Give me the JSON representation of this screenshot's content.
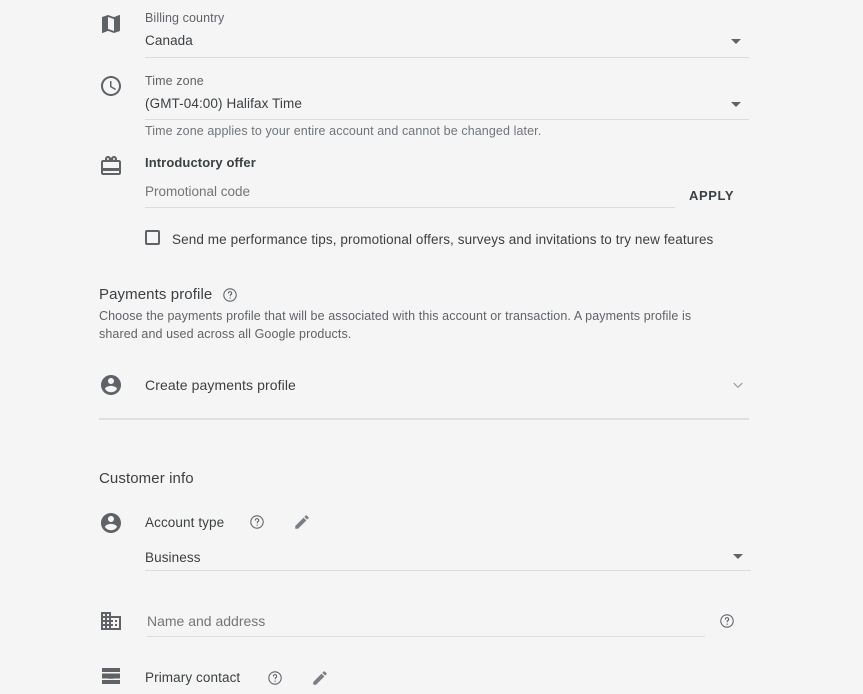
{
  "theme": {
    "background": "#f5f5f5",
    "text_primary": "#3c4043",
    "text_secondary": "#5f6368",
    "placeholder": "#9aa0a6",
    "rule": "#dadce0"
  },
  "billing_country": {
    "icon": "map-icon",
    "label": "Billing country",
    "value": "Canada",
    "dropdown_icon": "caret-down-icon"
  },
  "time_zone": {
    "icon": "clock-icon",
    "label": "Time zone",
    "value": "(GMT-04:00) Halifax Time",
    "dropdown_icon": "caret-down-icon",
    "hint": "Time zone applies to your entire account and cannot be changed later."
  },
  "introductory_offer": {
    "icon": "gift-card-icon",
    "label": "Introductory offer",
    "promo_placeholder": "Promotional code",
    "promo_value": "",
    "apply_label": "APPLY"
  },
  "marketing_optin": {
    "checked": false,
    "label": "Send me performance tips, promotional offers, surveys and invitations to try new features"
  },
  "payments_profile": {
    "title": "Payments profile",
    "help_icon": "help-circle-icon",
    "description": "Choose the payments profile that will be associated with this account or transaction. A payments profile is shared and used across all Google products.",
    "row": {
      "icon": "person-circle-icon",
      "label": "Create payments profile",
      "expander_icon": "chevron-down-icon"
    }
  },
  "customer_info": {
    "title": "Customer info",
    "account_type": {
      "icon": "person-circle-icon",
      "label": "Account type",
      "help_icon": "help-circle-icon",
      "edit_icon": "pencil-icon",
      "value": "Business",
      "dropdown_icon": "caret-down-icon"
    },
    "name_and_address": {
      "icon": "building-icon",
      "placeholder": "Name and address",
      "value": "",
      "help_icon": "help-circle-icon"
    },
    "primary_contact": {
      "icon": "contact-card-icon",
      "label": "Primary contact",
      "help_icon": "help-circle-icon",
      "edit_icon": "pencil-icon"
    }
  }
}
